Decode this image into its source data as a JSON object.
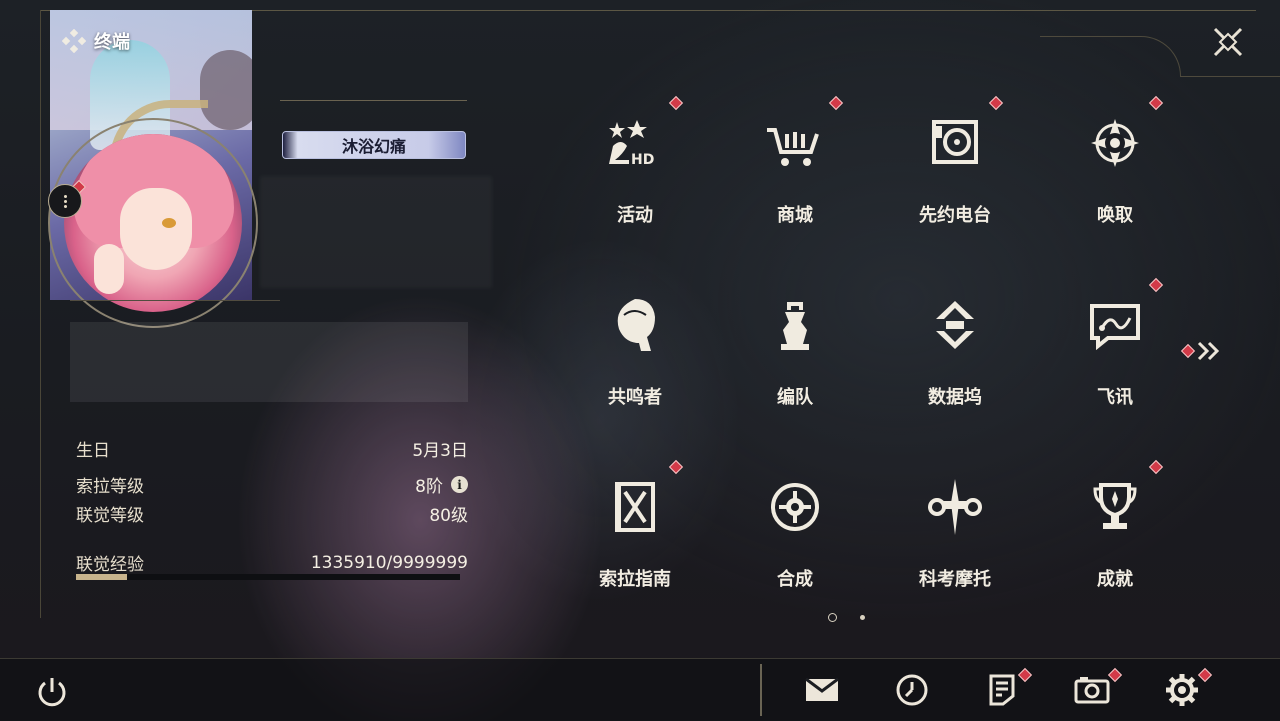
{
  "panel": {
    "title": "终端",
    "nickname_badge": "沐浴幻痛"
  },
  "stats": {
    "birthday_label": "生日",
    "birthday_value": "5月3日",
    "sola_level_label": "索拉等级",
    "sola_level_value": "8阶",
    "union_level_label": "联觉等级",
    "union_level_value": "80级",
    "union_exp_label": "联觉经验",
    "union_exp_value": "1335910/9999999",
    "union_exp_fraction": 0.1336
  },
  "menu": [
    {
      "label": "活动",
      "icon": "activity-icon",
      "badge": true
    },
    {
      "label": "商城",
      "icon": "shop-cart-icon",
      "badge": true
    },
    {
      "label": "先约电台",
      "icon": "radio-icon",
      "badge": true
    },
    {
      "label": "唤取",
      "icon": "convene-icon",
      "badge": true
    },
    {
      "label": "共鸣者",
      "icon": "resonator-icon",
      "badge": false
    },
    {
      "label": "编队",
      "icon": "team-icon",
      "badge": false
    },
    {
      "label": "数据坞",
      "icon": "data-bank-icon",
      "badge": false
    },
    {
      "label": "飞讯",
      "icon": "message-icon",
      "badge": true
    },
    {
      "label": "索拉指南",
      "icon": "guide-icon",
      "badge": true
    },
    {
      "label": "合成",
      "icon": "synthesis-icon",
      "badge": false
    },
    {
      "label": "科考摩托",
      "icon": "motorcycle-icon",
      "badge": false
    },
    {
      "label": "成就",
      "icon": "trophy-icon",
      "badge": true
    }
  ],
  "pager": {
    "current": 1,
    "total": 2
  },
  "bottom_icons": [
    "power-icon",
    "mail-icon",
    "clock-icon",
    "notice-icon",
    "camera-icon",
    "settings-icon"
  ],
  "colors": {
    "accent": "#c8b48c",
    "badge_red": "#d23a48",
    "bg": "#1b1d22"
  }
}
